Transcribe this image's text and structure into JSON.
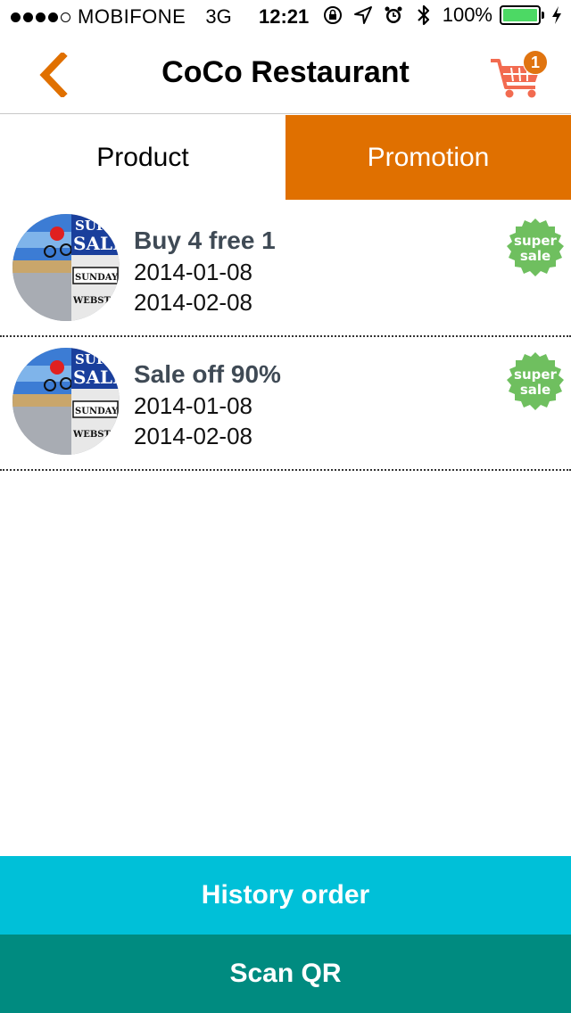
{
  "status_bar": {
    "carrier": "MOBIFONE",
    "network": "3G",
    "time": "12:21",
    "battery": "100%",
    "signal_bars_filled": 4,
    "signal_bars_total": 5
  },
  "nav": {
    "title": "CoCo Restaurant",
    "back_icon": "chevron-left-icon",
    "cart_icon": "shopping-cart-icon",
    "cart_count": "1"
  },
  "tabs": [
    {
      "label": "Product",
      "active": false
    },
    {
      "label": "Promotion",
      "active": true
    }
  ],
  "promotions": [
    {
      "title": "Buy 4 free 1",
      "start_date": "2014-01-08",
      "end_date": "2014-02-08",
      "badge": "super sale",
      "thumb_text": {
        "line1": "SUPER",
        "line2": "SALE",
        "line3": "SUNDAY",
        "line4": "WEBSTORE"
      }
    },
    {
      "title": "Sale off 90%",
      "start_date": "2014-01-08",
      "end_date": "2014-02-08",
      "badge": "super sale",
      "thumb_text": {
        "line1": "SUPER",
        "line2": "SALE",
        "line3": "SUNDAY",
        "line4": "WEBSTORE"
      }
    }
  ],
  "badge_text": {
    "line1": "super",
    "line2": "sale"
  },
  "buttons": {
    "history": "History order",
    "scan": "Scan QR"
  },
  "colors": {
    "accent_orange": "#e07000",
    "history_cyan": "#00c0d8",
    "scan_teal": "#008b80",
    "badge_green": "#6fbf5f",
    "battery_green": "#4cd964"
  }
}
